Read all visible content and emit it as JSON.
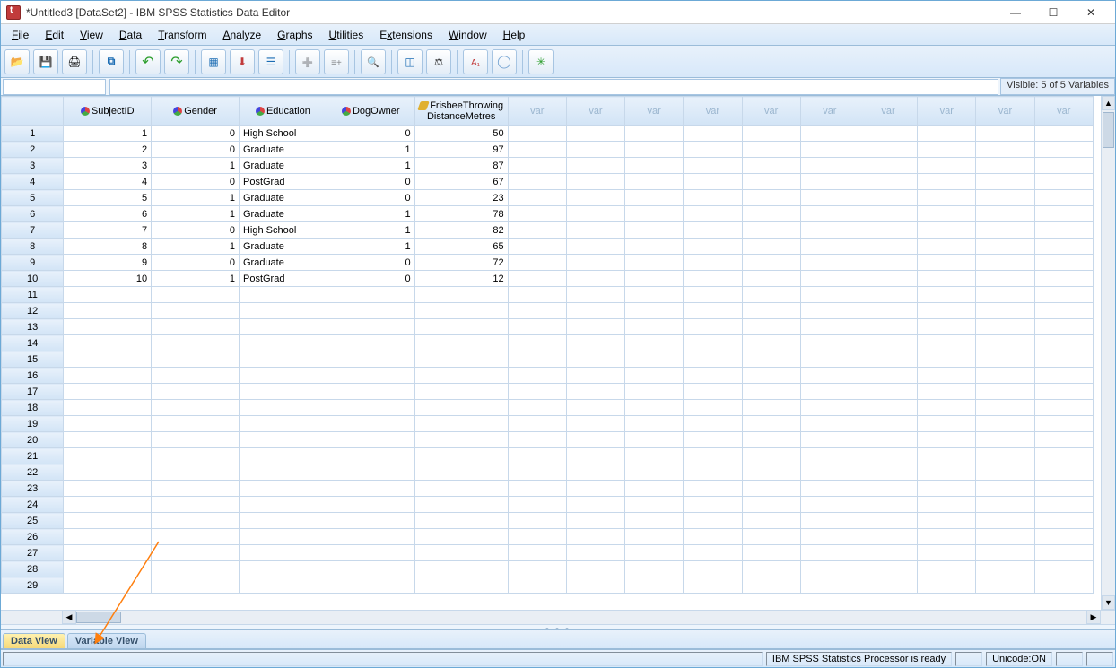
{
  "title": "*Untitled3 [DataSet2] - IBM SPSS Statistics Data Editor",
  "window_buttons": {
    "min": "—",
    "max": "☐",
    "close": "✕"
  },
  "menus": [
    "File",
    "Edit",
    "View",
    "Data",
    "Transform",
    "Analyze",
    "Graphs",
    "Utilities",
    "Extensions",
    "Window",
    "Help"
  ],
  "visible_label": "Visible: 5 of 5 Variables",
  "columns": [
    {
      "name": "SubjectID",
      "type": "nominal",
      "align": "num",
      "width": 96
    },
    {
      "name": "Gender",
      "type": "nominal",
      "align": "num",
      "width": 96
    },
    {
      "name": "Education",
      "type": "nominal",
      "align": "txt",
      "width": 96
    },
    {
      "name": "DogOwner",
      "type": "nominal",
      "align": "num",
      "width": 96
    },
    {
      "name": "FrisbeeThrowingDistanceMetres",
      "type": "ruler",
      "align": "num",
      "width": 102
    }
  ],
  "empty_col_label": "var",
  "empty_cols": 10,
  "rows": [
    {
      "SubjectID": "1",
      "Gender": "0",
      "Education": "High School",
      "DogOwner": "0",
      "FrisbeeThrowingDistanceMetres": "50"
    },
    {
      "SubjectID": "2",
      "Gender": "0",
      "Education": "Graduate",
      "DogOwner": "1",
      "FrisbeeThrowingDistanceMetres": "97"
    },
    {
      "SubjectID": "3",
      "Gender": "1",
      "Education": "Graduate",
      "DogOwner": "1",
      "FrisbeeThrowingDistanceMetres": "87"
    },
    {
      "SubjectID": "4",
      "Gender": "0",
      "Education": "PostGrad",
      "DogOwner": "0",
      "FrisbeeThrowingDistanceMetres": "67"
    },
    {
      "SubjectID": "5",
      "Gender": "1",
      "Education": "Graduate",
      "DogOwner": "0",
      "FrisbeeThrowingDistanceMetres": "23"
    },
    {
      "SubjectID": "6",
      "Gender": "1",
      "Education": "Graduate",
      "DogOwner": "1",
      "FrisbeeThrowingDistanceMetres": "78"
    },
    {
      "SubjectID": "7",
      "Gender": "0",
      "Education": "High School",
      "DogOwner": "1",
      "FrisbeeThrowingDistanceMetres": "82"
    },
    {
      "SubjectID": "8",
      "Gender": "1",
      "Education": "Graduate",
      "DogOwner": "1",
      "FrisbeeThrowingDistanceMetres": "65"
    },
    {
      "SubjectID": "9",
      "Gender": "0",
      "Education": "Graduate",
      "DogOwner": "0",
      "FrisbeeThrowingDistanceMetres": "72"
    },
    {
      "SubjectID": "10",
      "Gender": "1",
      "Education": "PostGrad",
      "DogOwner": "0",
      "FrisbeeThrowingDistanceMetres": "12"
    }
  ],
  "total_rows": 29,
  "tabs": {
    "data": "Data View",
    "variable": "Variable View"
  },
  "status": {
    "processor": "IBM SPSS Statistics Processor is ready",
    "unicode": "Unicode:ON"
  },
  "toolbar_buttons": [
    {
      "id": "open",
      "icon": "g-open"
    },
    {
      "id": "save",
      "icon": "g-save"
    },
    {
      "id": "print",
      "icon": "g-print"
    },
    {
      "id": "sep"
    },
    {
      "id": "recall-dialog",
      "icon": "g-dialog"
    },
    {
      "id": "sep"
    },
    {
      "id": "undo",
      "icon": "g-undo"
    },
    {
      "id": "redo",
      "icon": "g-redo"
    },
    {
      "id": "sep"
    },
    {
      "id": "goto-case",
      "icon": "g-goto"
    },
    {
      "id": "goto-var",
      "icon": "g-gotovar"
    },
    {
      "id": "variables",
      "icon": "g-vars"
    },
    {
      "id": "sep"
    },
    {
      "id": "run-desc",
      "icon": "g-insertcase",
      "dim": true
    },
    {
      "id": "run-desc2",
      "icon": "g-insertvar",
      "dim": true
    },
    {
      "id": "sep"
    },
    {
      "id": "find",
      "icon": "g-find"
    },
    {
      "id": "sep"
    },
    {
      "id": "split-file",
      "icon": "g-split"
    },
    {
      "id": "weight",
      "icon": "g-weight"
    },
    {
      "id": "sep"
    },
    {
      "id": "value-labels",
      "icon": "g-value"
    },
    {
      "id": "use-sets",
      "icon": "g-sets"
    },
    {
      "id": "sep"
    },
    {
      "id": "customize",
      "icon": "g-customize"
    }
  ]
}
